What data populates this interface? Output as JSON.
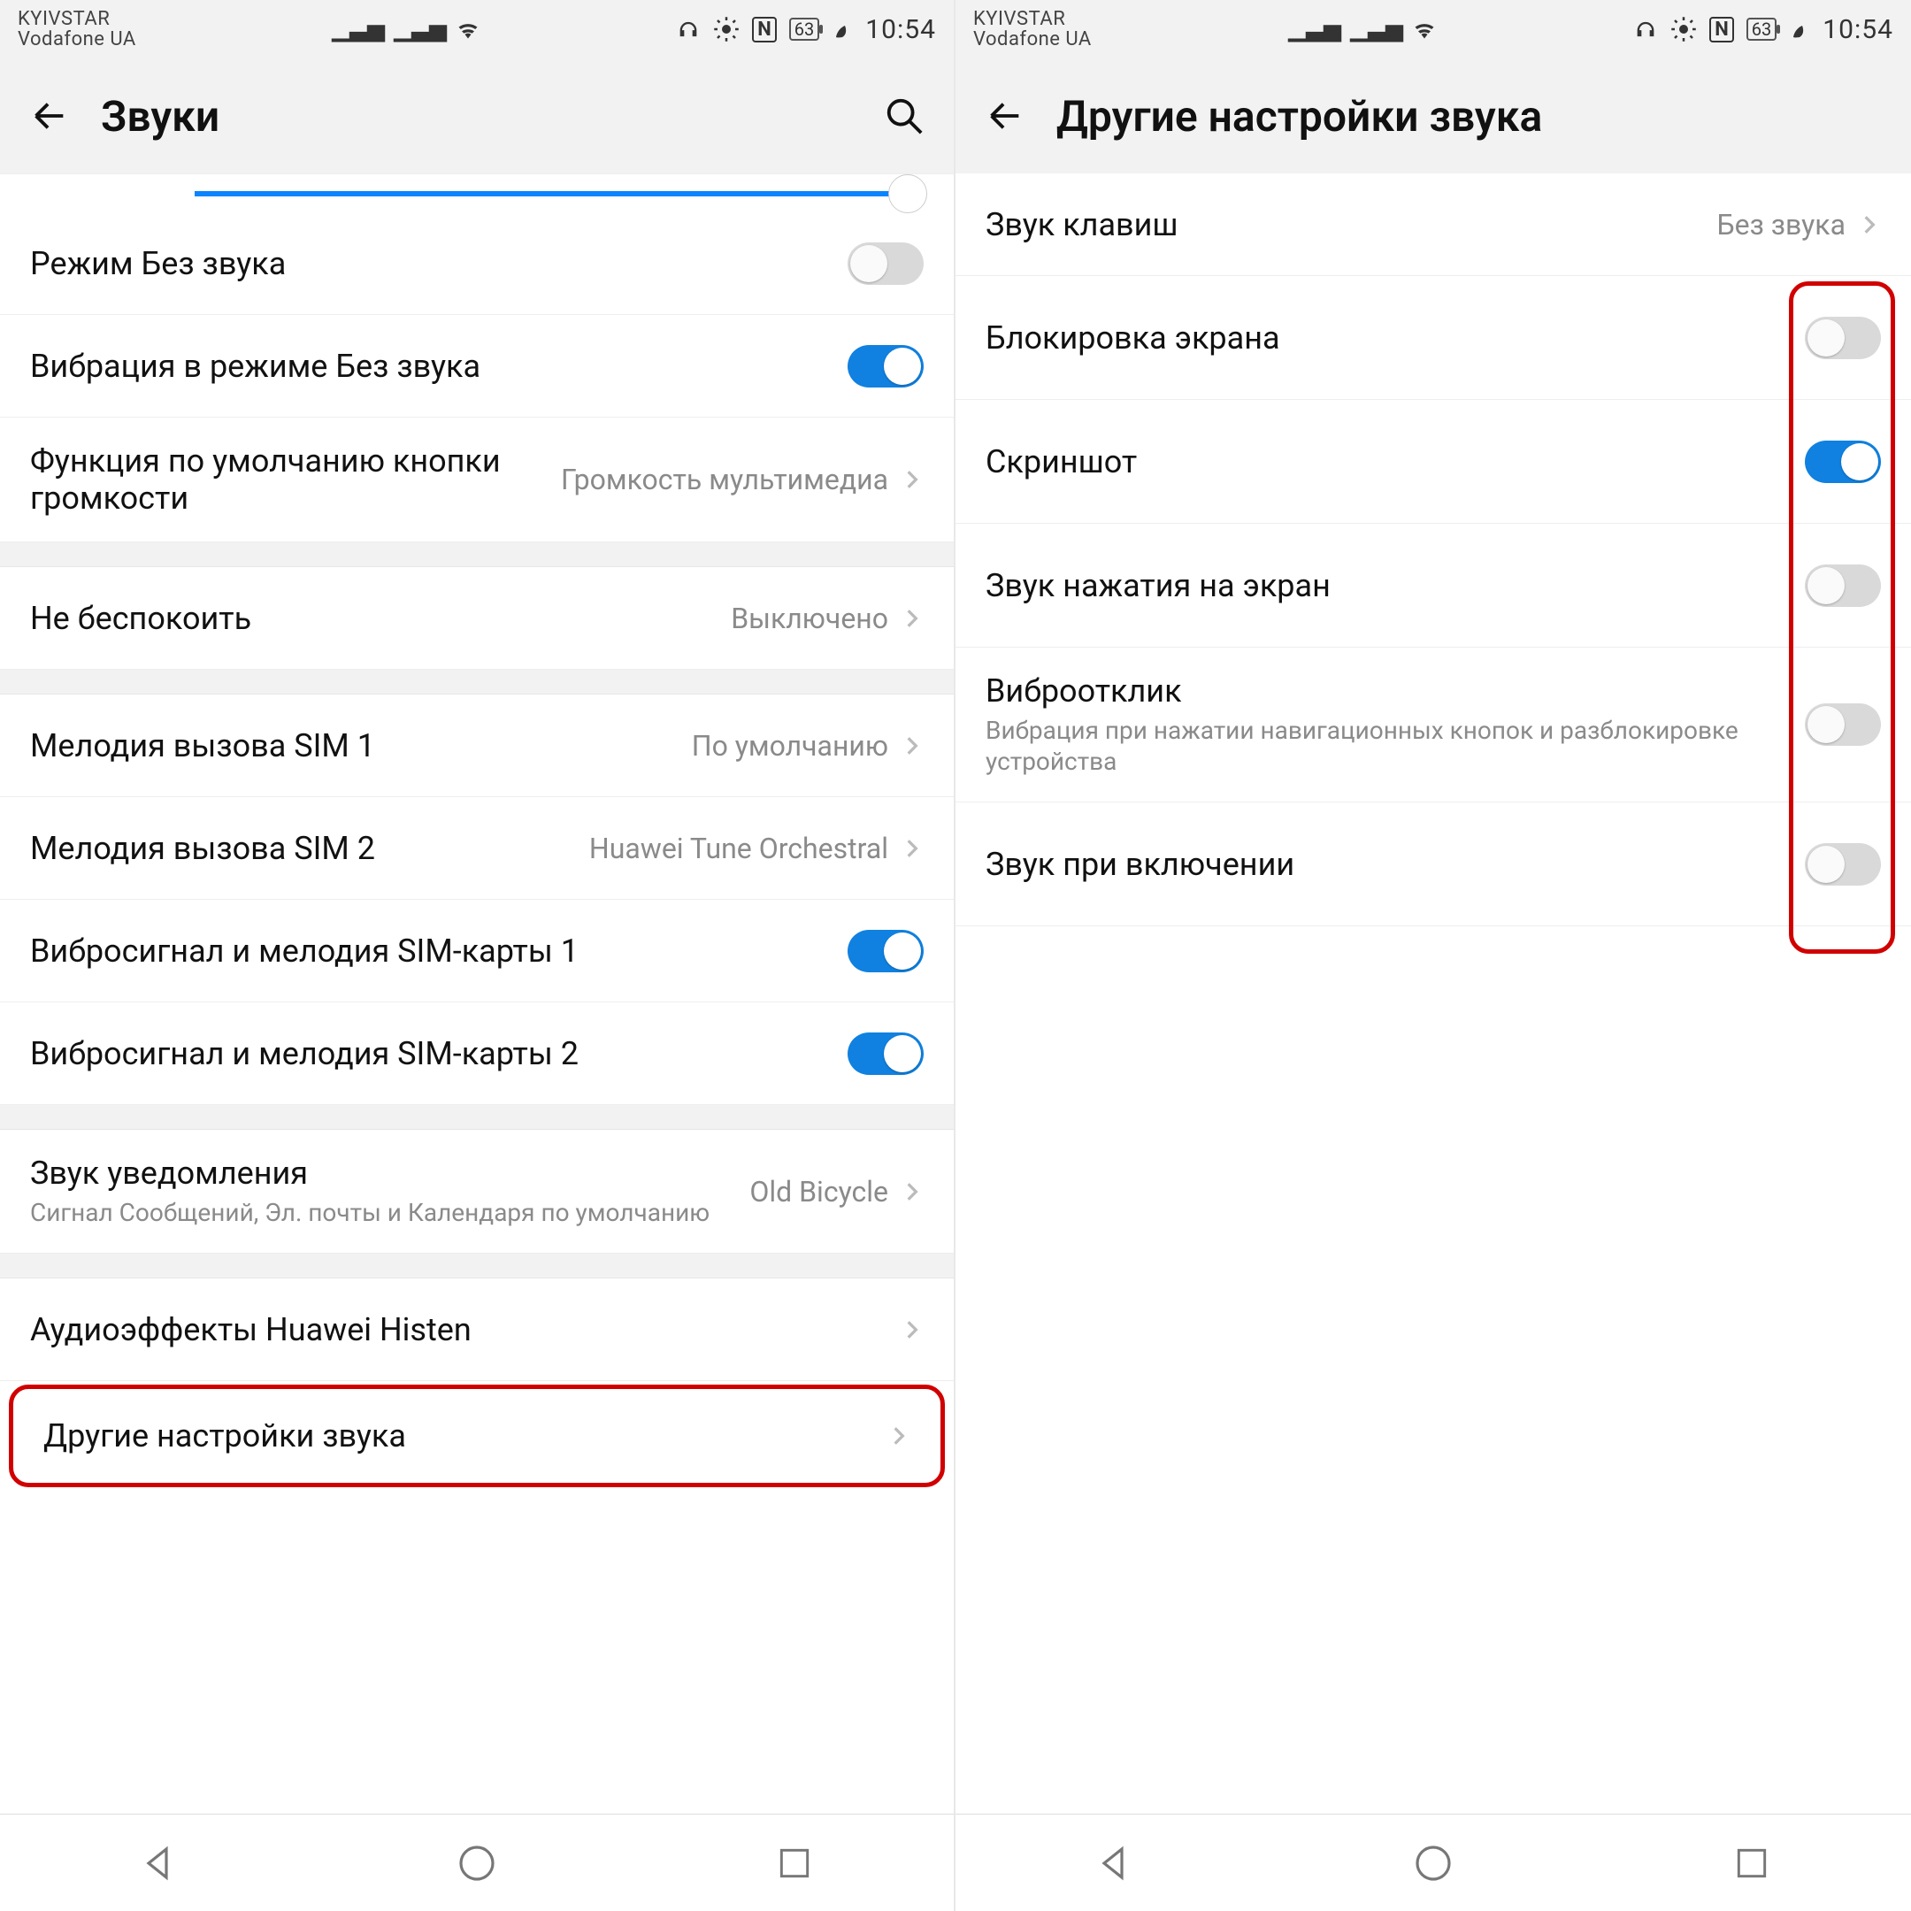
{
  "status": {
    "carrier1": "KYIVSTAR",
    "carrier2": "Vodafone UA",
    "battery": "63",
    "time": "10:54"
  },
  "left": {
    "title": "Звуки",
    "rows": {
      "silent": {
        "label": "Режим Без звука"
      },
      "vibr_silent": {
        "label": "Вибрация в режиме Без звука"
      },
      "vol_default": {
        "label": "Функция по умолчанию кнопки громкости",
        "value": "Громкость мультимедиа"
      },
      "dnd": {
        "label": "Не беспокоить",
        "value": "Выключено"
      },
      "ring1": {
        "label": "Мелодия вызова SIM 1",
        "value": "По умолчанию"
      },
      "ring2": {
        "label": "Мелодия вызова SIM 2",
        "value": "Huawei Tune Orchestral"
      },
      "vibmel1": {
        "label": "Вибросигнал и мелодия SIM-карты 1"
      },
      "vibmel2": {
        "label": "Вибросигнал и мелодия SIM-карты 2"
      },
      "notif": {
        "label": "Звук уведомления",
        "sub": "Сигнал Сообщений, Эл. почты и Календаря по умолчанию",
        "value": "Old Bicycle"
      },
      "histen": {
        "label": "Аудиоэффекты Huawei Histen"
      },
      "other": {
        "label": "Другие настройки звука"
      }
    }
  },
  "right": {
    "title": "Другие настройки звука",
    "rows": {
      "dial": {
        "label": "Звук клавиш",
        "value": "Без звука"
      },
      "lock": {
        "label": "Блокировка экрана"
      },
      "shot": {
        "label": "Скриншот"
      },
      "touch": {
        "label": "Звук нажатия на экран"
      },
      "haptic": {
        "label": "Виброотклик",
        "sub": "Вибрация при нажатии навигационных кнопок и разблокировке устройства"
      },
      "startup": {
        "label": "Звук при включении"
      }
    }
  }
}
